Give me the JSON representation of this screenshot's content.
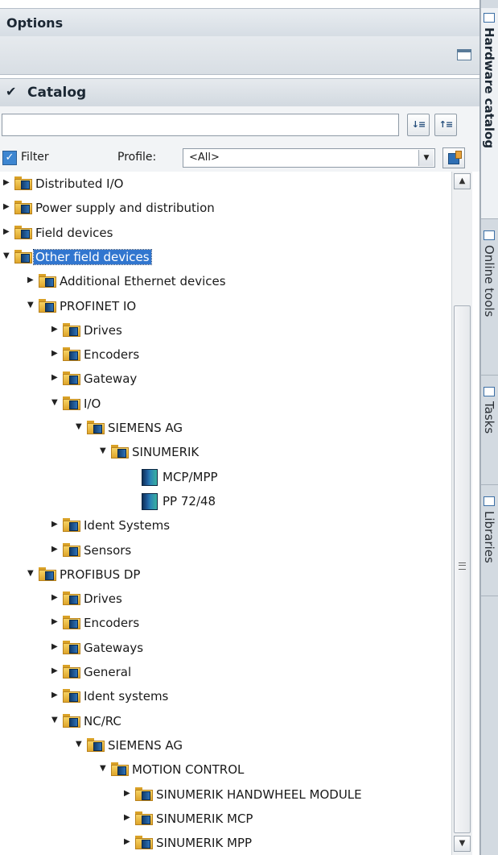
{
  "options": {
    "title": "Options"
  },
  "catalog": {
    "title": "Catalog",
    "search": {
      "value": "",
      "placeholder": ""
    },
    "search_down_icon": "search-down-icon",
    "search_up_icon": "search-up-icon",
    "filter": {
      "label": "Filter",
      "checked": true
    },
    "profile": {
      "label": "Profile:",
      "value": "<All>"
    }
  },
  "tree": [
    {
      "label": "Distributed I/O",
      "indent": 0,
      "type": "folder",
      "state": "collapsed"
    },
    {
      "label": "Power supply and distribution",
      "indent": 0,
      "type": "folder",
      "state": "collapsed"
    },
    {
      "label": "Field devices",
      "indent": 0,
      "type": "folder",
      "state": "collapsed"
    },
    {
      "label": "Other field devices",
      "indent": 0,
      "type": "folder",
      "state": "expanded",
      "selected": true
    },
    {
      "label": "Additional Ethernet devices",
      "indent": 1,
      "type": "folder",
      "state": "collapsed"
    },
    {
      "label": "PROFINET IO",
      "indent": 1,
      "type": "folder",
      "state": "expanded"
    },
    {
      "label": "Drives",
      "indent": 2,
      "type": "folder",
      "state": "collapsed"
    },
    {
      "label": "Encoders",
      "indent": 2,
      "type": "folder",
      "state": "collapsed"
    },
    {
      "label": "Gateway",
      "indent": 2,
      "type": "folder",
      "state": "collapsed"
    },
    {
      "label": "I/O",
      "indent": 2,
      "type": "folder",
      "state": "expanded"
    },
    {
      "label": "SIEMENS AG",
      "indent": 3,
      "type": "folder",
      "state": "expanded"
    },
    {
      "label": "SINUMERIK",
      "indent": 4,
      "type": "folder",
      "state": "expanded"
    },
    {
      "label": "MCP/MPP",
      "indent": 5,
      "type": "device"
    },
    {
      "label": "PP 72/48",
      "indent": 5,
      "type": "device"
    },
    {
      "label": "Ident Systems",
      "indent": 2,
      "type": "folder",
      "state": "collapsed"
    },
    {
      "label": "Sensors",
      "indent": 2,
      "type": "folder",
      "state": "collapsed"
    },
    {
      "label": "PROFIBUS DP",
      "indent": 1,
      "type": "folder",
      "state": "expanded"
    },
    {
      "label": "Drives",
      "indent": 2,
      "type": "folder",
      "state": "collapsed"
    },
    {
      "label": "Encoders",
      "indent": 2,
      "type": "folder",
      "state": "collapsed"
    },
    {
      "label": "Gateways",
      "indent": 2,
      "type": "folder",
      "state": "collapsed"
    },
    {
      "label": "General",
      "indent": 2,
      "type": "folder",
      "state": "collapsed"
    },
    {
      "label": "Ident systems",
      "indent": 2,
      "type": "folder",
      "state": "collapsed"
    },
    {
      "label": "NC/RC",
      "indent": 2,
      "type": "folder",
      "state": "expanded"
    },
    {
      "label": "SIEMENS AG",
      "indent": 3,
      "type": "folder",
      "state": "expanded"
    },
    {
      "label": "MOTION CONTROL",
      "indent": 4,
      "type": "folder",
      "state": "expanded"
    },
    {
      "label": "SINUMERIK HANDWHEEL MODULE",
      "indent": 5,
      "type": "folder",
      "state": "collapsed"
    },
    {
      "label": "SINUMERIK MCP",
      "indent": 5,
      "type": "folder",
      "state": "collapsed"
    },
    {
      "label": "SINUMERIK MPP",
      "indent": 5,
      "type": "folder",
      "state": "collapsed"
    }
  ],
  "sidebar": {
    "tabs": [
      {
        "label": "Hardware catalog",
        "active": true,
        "icon": "catalog-icon"
      },
      {
        "label": "Online tools",
        "active": false,
        "icon": "online-tools-icon"
      },
      {
        "label": "Tasks",
        "active": false,
        "icon": "tasks-icon"
      },
      {
        "label": "Libraries",
        "active": false,
        "icon": "libraries-icon"
      }
    ]
  }
}
